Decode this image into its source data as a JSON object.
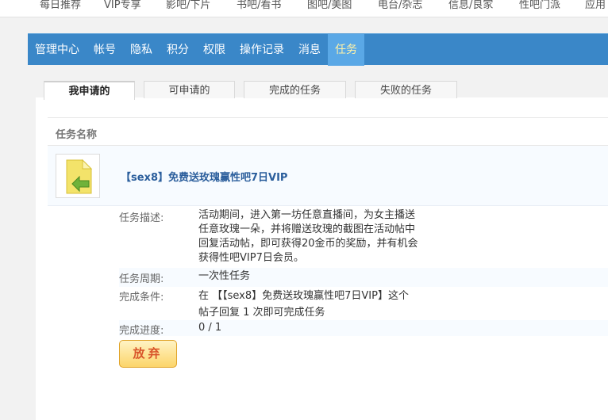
{
  "topnav": {
    "items": [
      "每日推荐",
      "VIP专享",
      "影吧/下片",
      "书吧/看书",
      "图吧/美图",
      "电台/杂志",
      "信息/良家",
      "性吧门派",
      "应用"
    ]
  },
  "mainnav": {
    "items": [
      "管理中心",
      "帐号",
      "隐私",
      "积分",
      "权限",
      "操作记录",
      "消息",
      "任务"
    ],
    "active_index": 7
  },
  "subtabs": {
    "items": [
      "我申请的",
      "可申请的",
      "完成的任务",
      "失败的任务"
    ],
    "active_index": 0
  },
  "table": {
    "header": "任务名称"
  },
  "task": {
    "title": "【sex8】免费送玫瑰赢性吧7日VIP",
    "icon": "file-arrow-icon",
    "description_label": "任务描述:",
    "description_lines": [
      "活动期间，进入第一坊任意直播间，为女主播送",
      "任意玫瑰一朵，并将赠送玫瑰的截图在活动帖中",
      "回复活动帖，即可获得20金币的奖励，并有机会",
      "获得性吧VIP7日会员。"
    ],
    "period_label": "任务周期:",
    "period_value": "一次性任务",
    "condition_label": "完成条件:",
    "condition_lines": [
      "在 【【sex8】免费送玫瑰赢性吧7日VIP】这个",
      "帖子回复 1 次即可完成任务"
    ],
    "progress_label": "完成进度:",
    "progress_value": "0 / 1",
    "giveup_label": "放弃"
  },
  "colors": {
    "nav_bg": "#3a87c8",
    "nav_active_bg": "#5aa8e6",
    "title_blue": "#2b5e9c",
    "button_text": "#d8542a"
  }
}
